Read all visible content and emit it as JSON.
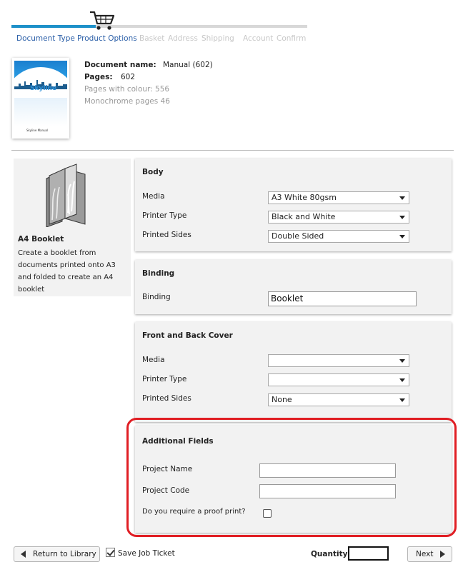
{
  "steps": [
    "Document Type",
    "Product Options",
    "Basket",
    "Address",
    "Shipping",
    "Account",
    "Confirm"
  ],
  "progress_fraction": 0.285,
  "document": {
    "thumbnail_logo": "Skyline",
    "thumbnail_caption": "Skyline Manual",
    "name_label": "Document name:",
    "name_value": "Manual (602)",
    "pages_label": "Pages:",
    "pages_value": "602",
    "colour_pages": "Pages with colour: 556",
    "mono_pages": "Monochrome pages 46"
  },
  "product": {
    "title": "A4 Booklet",
    "description": "Create a booklet from documents printed onto A3 and folded to create an A4 booklet"
  },
  "body_panel": {
    "title": "Body",
    "media_label": "Media",
    "media_value": "A3 White 80gsm",
    "printer_type_label": "Printer Type",
    "printer_type_value": "Black and White",
    "printed_sides_label": "Printed Sides",
    "printed_sides_value": "Double Sided"
  },
  "binding_panel": {
    "title": "Binding",
    "binding_label": "Binding",
    "binding_value": "Booklet"
  },
  "cover_panel": {
    "title": "Front and Back Cover",
    "media_label": "Media",
    "media_value": "",
    "printer_type_label": "Printer Type",
    "printer_type_value": "",
    "printed_sides_label": "Printed Sides",
    "printed_sides_value": "None"
  },
  "additional_panel": {
    "title": "Additional Fields",
    "project_name_label": "Project Name",
    "project_name_value": "",
    "project_code_label": "Project Code",
    "project_code_value": "",
    "proof_label": "Do you require a proof print?",
    "proof_checked": false
  },
  "footer": {
    "return_label": "Return to Library",
    "save_ticket_label": "Save Job Ticket",
    "save_ticket_checked": true,
    "quantity_label": "Quantity",
    "quantity_value": "",
    "next_label": "Next"
  },
  "colors": {
    "accent": "#1e90c9",
    "active_step": "#2b5fa8",
    "highlight_border": "#e01e24"
  }
}
